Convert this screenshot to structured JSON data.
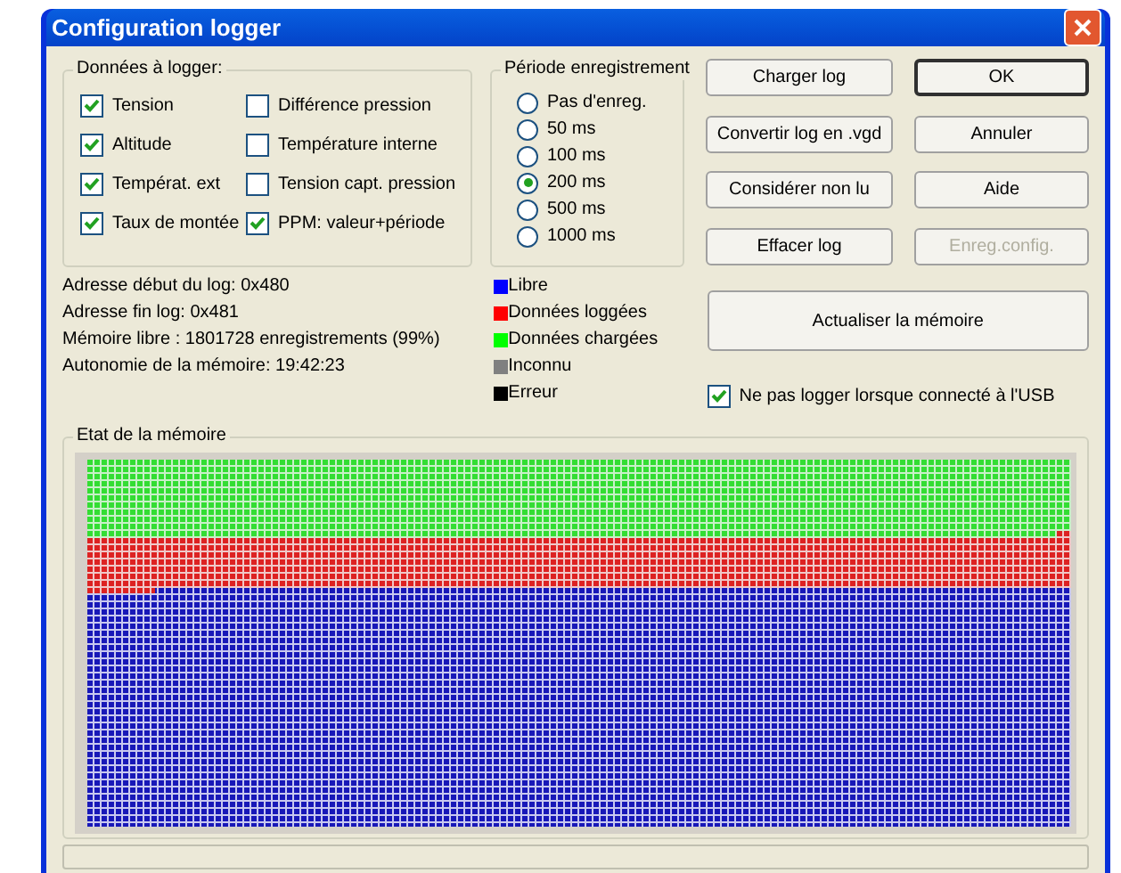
{
  "window": {
    "title": "Configuration logger"
  },
  "data_group": {
    "title": "Données à logger:",
    "items": [
      {
        "label": "Tension",
        "checked": true
      },
      {
        "label": "Différence pression",
        "checked": false
      },
      {
        "label": "Altitude",
        "checked": true
      },
      {
        "label": "Température interne",
        "checked": false
      },
      {
        "label": "Températ. ext",
        "checked": true
      },
      {
        "label": "Tension capt. pression",
        "checked": false
      },
      {
        "label": "Taux de montée",
        "checked": true
      },
      {
        "label": "PPM: valeur+période",
        "checked": true
      }
    ]
  },
  "period_group": {
    "title": "Période enregistrement",
    "options": [
      {
        "label": "Pas d'enreg.",
        "selected": false
      },
      {
        "label": "50 ms",
        "selected": false
      },
      {
        "label": "100 ms",
        "selected": false
      },
      {
        "label": "200 ms",
        "selected": true
      },
      {
        "label": "500 ms",
        "selected": false
      },
      {
        "label": "1000 ms",
        "selected": false
      }
    ]
  },
  "buttons": [
    {
      "label": "Charger log",
      "disabled": false,
      "default": false
    },
    {
      "label": "OK",
      "disabled": false,
      "default": true
    },
    {
      "label": "Convertir log en .vgd",
      "disabled": false,
      "default": false
    },
    {
      "label": "Annuler",
      "disabled": false,
      "default": false
    },
    {
      "label": "Considérer non lu",
      "disabled": false,
      "default": false
    },
    {
      "label": "Aide",
      "disabled": false,
      "default": false
    },
    {
      "label": "Effacer log",
      "disabled": false,
      "default": false
    },
    {
      "label": "Enreg.config.",
      "disabled": true,
      "default": false
    }
  ],
  "info": [
    "Adresse début du log: 0x480",
    "Adresse fin log: 0x481",
    "Mémoire libre : 1801728 enregistrements (99%)",
    "Autonomie de la mémoire: 19:42:23"
  ],
  "legend": [
    {
      "label": "Libre",
      "color": "#0000ff"
    },
    {
      "label": "Données loggées",
      "color": "#ff0000"
    },
    {
      "label": "Données chargées",
      "color": "#00ff00"
    },
    {
      "label": "Inconnu",
      "color": "#808080"
    },
    {
      "label": "Erreur",
      "color": "#000000"
    }
  ],
  "refresh_button": {
    "label": "Actualiser la mémoire"
  },
  "usb_option": {
    "label": "Ne pas logger lorsque connecté à l'USB",
    "checked": true
  },
  "memory_group": {
    "title": "Etat de la mémoire"
  }
}
